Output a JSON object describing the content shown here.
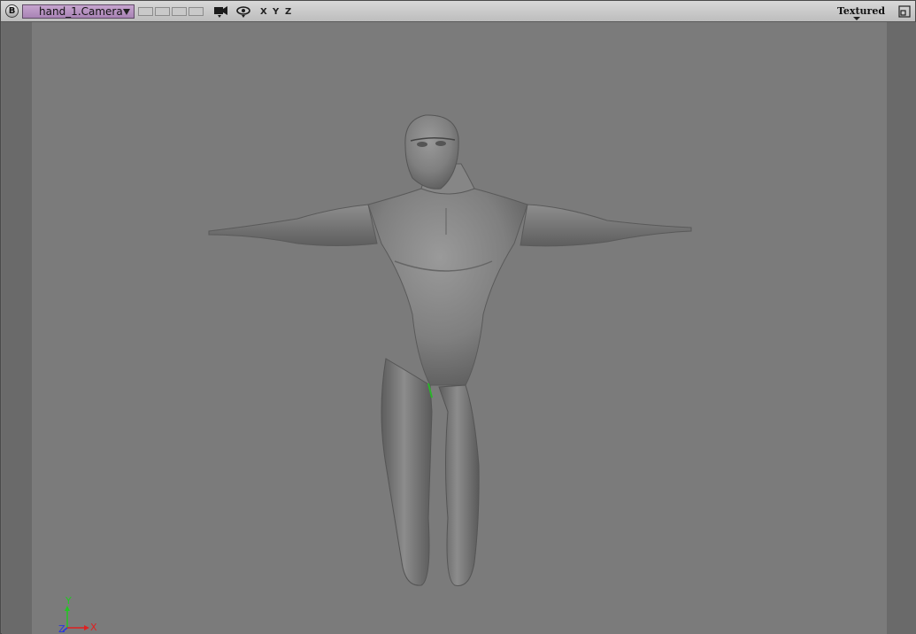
{
  "toolbar": {
    "menu_button_label": "B",
    "camera_label": "hand_1.Camera",
    "axes": [
      "X",
      "Y",
      "Z"
    ],
    "shading_mode": "Textured",
    "icons": {
      "camera": "camera-icon",
      "visibility": "eye-icon",
      "maximize": "maximize-icon"
    }
  },
  "viewport": {
    "object": "humanoid character mesh in T-pose",
    "axis_gizmo": {
      "x": "X",
      "y": "Y",
      "z": "Z"
    },
    "colors": {
      "background": "#7b7b7b",
      "axis_x": "#e02020",
      "axis_y": "#22c622",
      "axis_z": "#2a36e0"
    }
  }
}
